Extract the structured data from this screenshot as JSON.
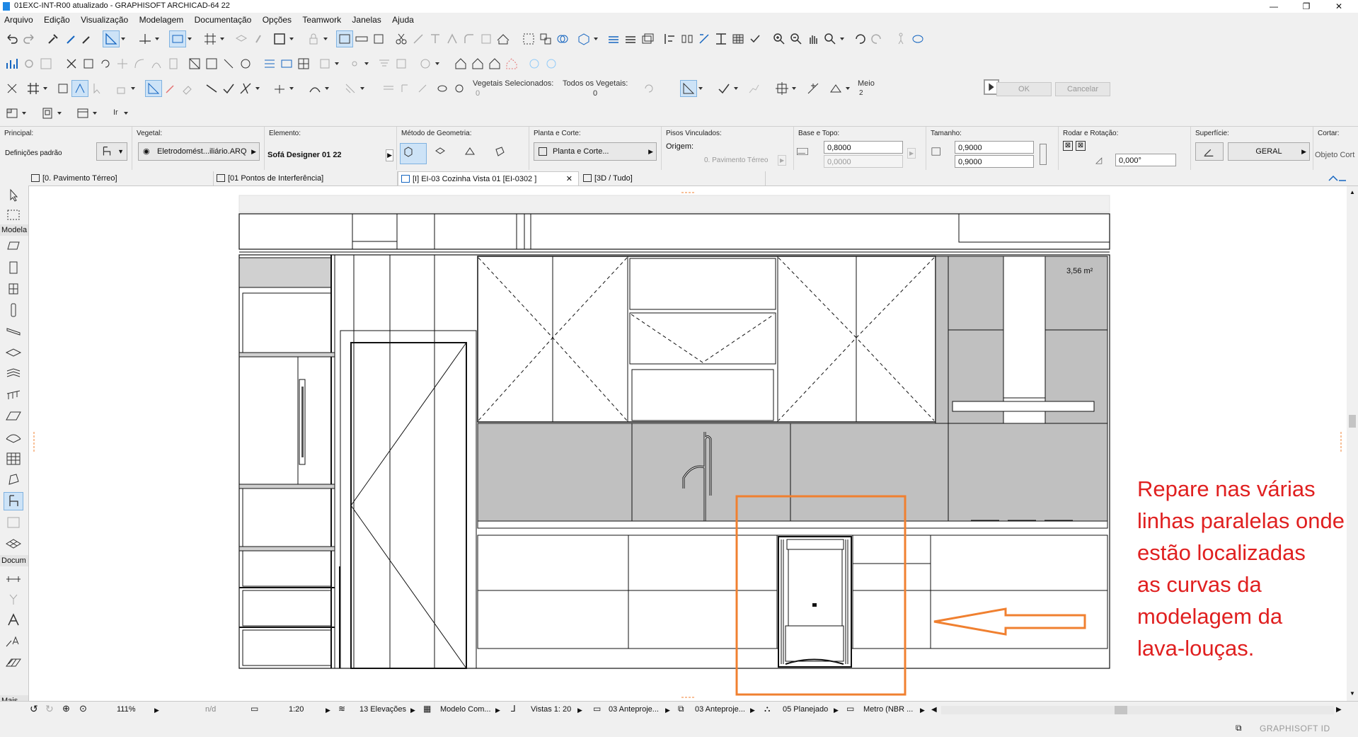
{
  "window": {
    "title": "01EXC-INT-R00 atualizado - GRAPHISOFT ARCHICAD-64 22",
    "minimize": "—",
    "maximize": "❐",
    "close": "✕"
  },
  "menu": [
    "Arquivo",
    "Edição",
    "Visualização",
    "Modelagem",
    "Documentação",
    "Opções",
    "Teamwork",
    "Janelas",
    "Ajuda"
  ],
  "toolbar": {
    "vegetais_selecionados": "Vegetais Selecionados:",
    "todos_vegetais": "Todos os Vegetais:",
    "meio": "Meio",
    "meio_count": "2",
    "zero_a": "0",
    "zero_b": "0",
    "ok": "OK",
    "cancel": "Cancelar",
    "ir": "Ir"
  },
  "infobox": {
    "principal_label": "Principal:",
    "principal_value": "Definições padrão",
    "vegetal_label": "Vegetal:",
    "vegetal_value": "Eletrodomést...iliário.ARQ",
    "elemento_label": "Elemento:",
    "elemento_value": "Sofá Designer 01 22",
    "metodo_label": "Método de Geometria:",
    "planta_label": "Planta e Corte:",
    "planta_value": "Planta e Corte...",
    "pisos_label": "Pisos Vinculados:",
    "origem_label": "Origem:",
    "origem_value": "0. Pavimento Térreo",
    "base_label": "Base e Topo:",
    "base_value1": "0,8000",
    "base_value2": "0,0000",
    "tamanho_label": "Tamanho:",
    "tamanho_value1": "0,9000",
    "tamanho_value2": "0,9000",
    "rodar_label": "Rodar e Rotação:",
    "rotacao_value": "0,000°",
    "superficie_label": "Superfície:",
    "superficie_value": "GERAL",
    "cortar_label": "Cortar:",
    "cortar_value": "Objeto Cort"
  },
  "tabs": [
    {
      "label": "[0. Pavimento Térreo]"
    },
    {
      "label": "[01 Pontos de Interferência]"
    },
    {
      "label": "[I] EI-03 Cozinha Vista 01 [EI-0302 ]",
      "close": "✕"
    },
    {
      "label": "[3D / Tudo]"
    }
  ],
  "toolbox": {
    "modelagem": "Modela",
    "documentacao": "Docum",
    "mais": "Mais"
  },
  "drawing": {
    "area_label": "3,56 m²"
  },
  "annotation": {
    "lines": [
      "Repare nas várias",
      "linhas paralelas onde",
      "estão localizadas",
      "as curvas da",
      "modelagem da",
      "lava-louças."
    ],
    "color": "#e02020",
    "highlight_color": "#f08030"
  },
  "statusbar": {
    "zoom": "111%",
    "nd": "n/d",
    "scale": "1:20",
    "elevations": "13 Elevações",
    "model": "Modelo Com...",
    "views": "Vistas 1: 20",
    "layer1": "03 Anteproje...",
    "layer2": "03 Anteproje...",
    "planejado": "05 Planejado",
    "units": "Metro (NBR ..."
  },
  "footer": {
    "brand": "GRAPHISOFT ID"
  }
}
